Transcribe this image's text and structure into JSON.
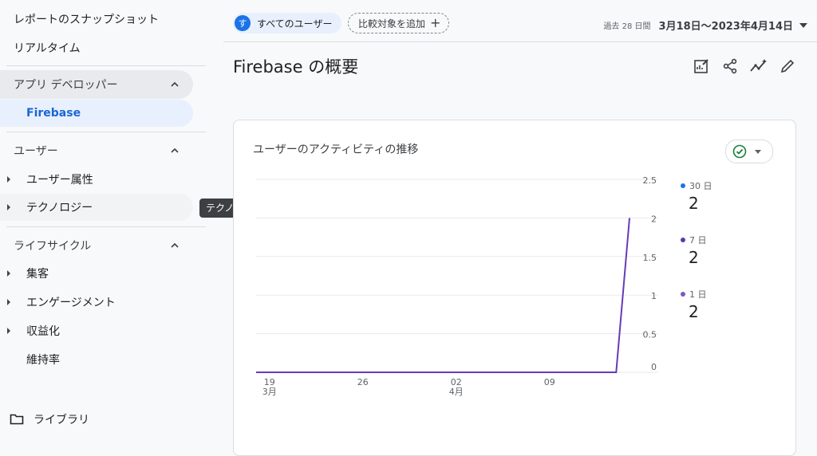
{
  "sidebar": {
    "top_items": [
      "レポートのスナップショット",
      "リアルタイム"
    ],
    "sections": [
      {
        "label": "アプリ デベロッパー",
        "items": [
          {
            "label": "Firebase"
          }
        ]
      },
      {
        "label": "ユーザー",
        "items": [
          {
            "label": "ユーザー属性"
          },
          {
            "label": "テクノロジー"
          }
        ]
      },
      {
        "label": "ライフサイクル",
        "items": [
          {
            "label": "集客"
          },
          {
            "label": "エンゲージメント"
          },
          {
            "label": "収益化"
          },
          {
            "label": "維持率"
          }
        ]
      }
    ],
    "library_label": "ライブラリ"
  },
  "tooltip": "テクノロジー",
  "topbar": {
    "user_badge": "す",
    "user_chip": "すべてのユーザー",
    "add_compare": "比較対象を追加",
    "date_prefix": "過去 28 日間",
    "date_range": "3月18日〜2023年4月14日"
  },
  "page_title": "Firebase の概要",
  "card": {
    "title": "ユーザーのアクティビティの推移"
  },
  "legend": [
    {
      "label": "30 日",
      "value": "2",
      "color": "#1a73e8"
    },
    {
      "label": "7 日",
      "value": "2",
      "color": "#5e35b1"
    },
    {
      "label": "1 日",
      "value": "2",
      "color": "#7e57c2"
    }
  ],
  "colors": {
    "accent": "#1a73e8",
    "series": "#673ab7"
  },
  "chart_data": {
    "type": "line",
    "y_ticks": [
      "2.5",
      "2",
      "1.5",
      "1",
      "0.5",
      "0"
    ],
    "x_ticks": [
      {
        "label": "19",
        "sub": "3月",
        "t": 1
      },
      {
        "label": "26",
        "sub": "",
        "t": 8
      },
      {
        "label": "02",
        "sub": "4月",
        "t": 15
      },
      {
        "label": "09",
        "sub": "",
        "t": 22
      }
    ],
    "ylim": [
      0,
      2.5
    ],
    "x_range": [
      0,
      28
    ],
    "series": [
      {
        "points": [
          [
            0,
            0
          ],
          [
            1,
            0
          ],
          [
            2,
            0
          ],
          [
            3,
            0
          ],
          [
            4,
            0
          ],
          [
            5,
            0
          ],
          [
            6,
            0
          ],
          [
            7,
            0
          ],
          [
            8,
            0
          ],
          [
            9,
            0
          ],
          [
            10,
            0
          ],
          [
            11,
            0
          ],
          [
            12,
            0
          ],
          [
            13,
            0
          ],
          [
            14,
            0
          ],
          [
            15,
            0
          ],
          [
            16,
            0
          ],
          [
            17,
            0
          ],
          [
            18,
            0
          ],
          [
            19,
            0
          ],
          [
            20,
            0
          ],
          [
            21,
            0
          ],
          [
            22,
            0
          ],
          [
            23,
            0
          ],
          [
            24,
            0
          ],
          [
            25,
            0
          ],
          [
            26,
            0
          ],
          [
            27,
            0
          ],
          [
            28,
            2
          ]
        ]
      }
    ]
  }
}
